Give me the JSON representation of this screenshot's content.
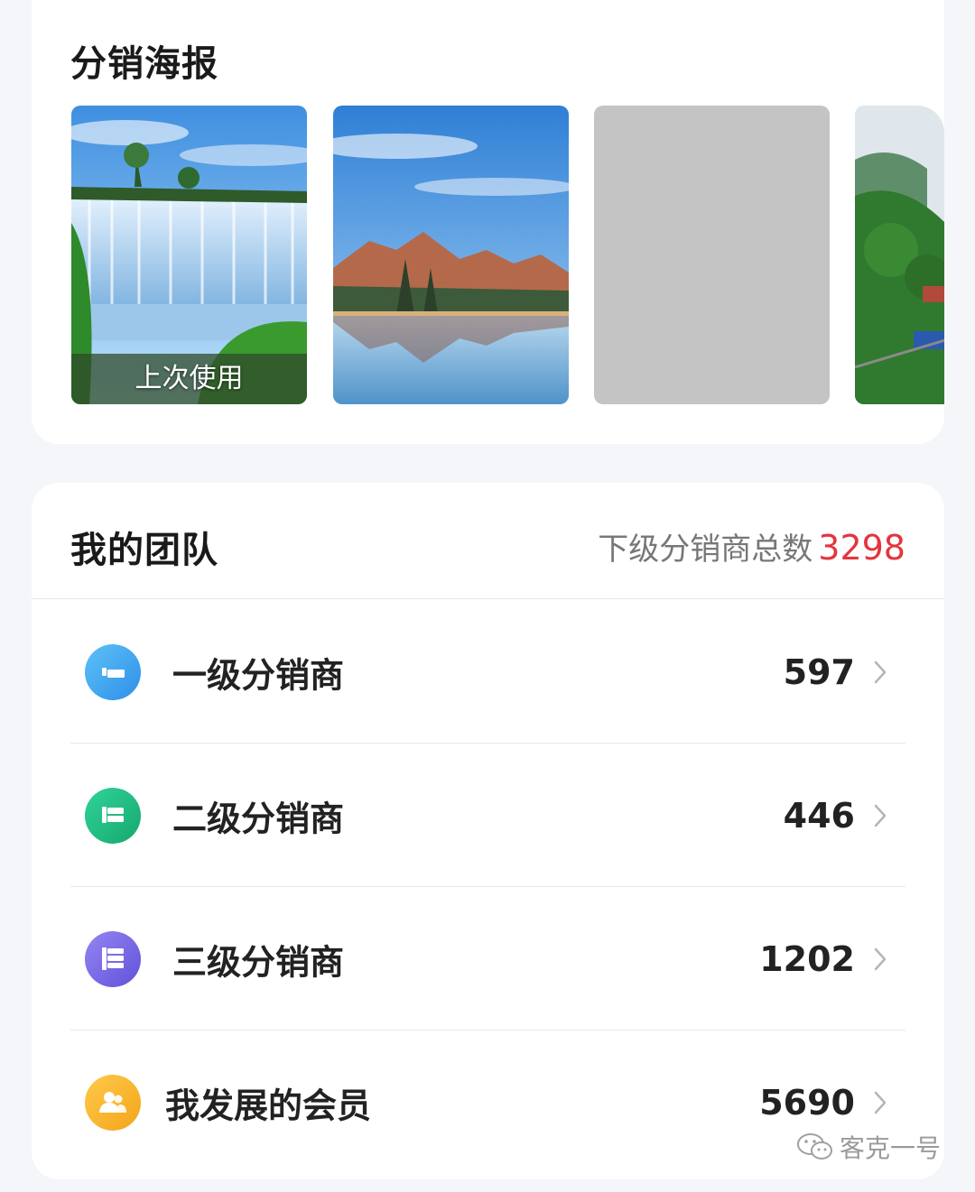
{
  "posters": {
    "title": "分销海报",
    "items": [
      {
        "scene": "waterfall",
        "tag": "上次使用"
      },
      {
        "scene": "mountain-lake",
        "tag": ""
      },
      {
        "scene": "blank",
        "tag": ""
      },
      {
        "scene": "forest-train",
        "tag": ""
      }
    ]
  },
  "team": {
    "title": "我的团队",
    "total_label": "下级分销商总数",
    "total_value": "3298",
    "total_color": "#e5343f",
    "rows": [
      {
        "label": "一级分销商",
        "value": "597",
        "icon": "level-1-icon",
        "color": "#3aa7f0"
      },
      {
        "label": "二级分销商",
        "value": "446",
        "icon": "level-2-icon",
        "color": "#1fbf84"
      },
      {
        "label": "三级分销商",
        "value": "1202",
        "icon": "level-3-icon",
        "color": "#7a6ae6"
      },
      {
        "label": "我发展的会员",
        "value": "5690",
        "icon": "members-icon",
        "color": "#f7b731"
      }
    ]
  },
  "watermark": "客克一号"
}
